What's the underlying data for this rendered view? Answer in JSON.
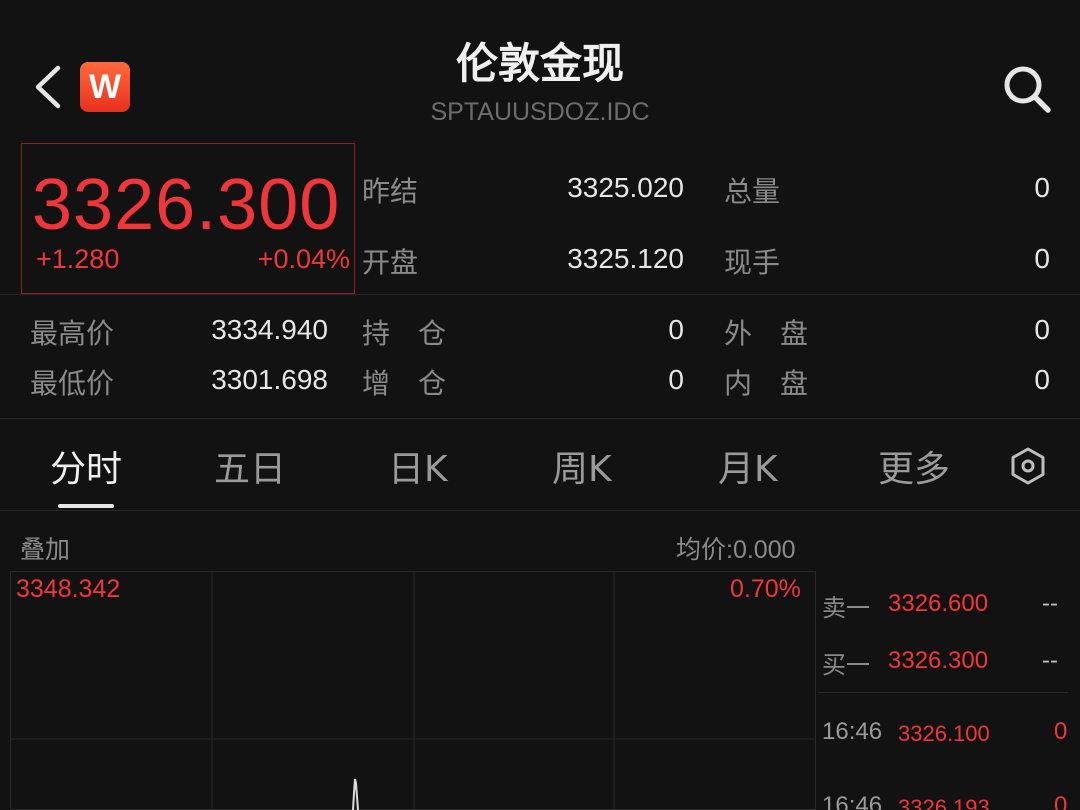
{
  "header": {
    "title": "伦敦金现",
    "symbol": "SPTAUUSDOZ.IDC",
    "logo_letter": "W"
  },
  "quote": {
    "price": "3326.300",
    "change": "+1.280",
    "change_pct": "+0.04%"
  },
  "stats": {
    "prev_settle_label": "昨结",
    "prev_settle": "3325.020",
    "total_vol_label": "总量",
    "total_vol": "0",
    "open_label": "开盘",
    "open": "3325.120",
    "cur_vol_label": "现手",
    "cur_vol": "0",
    "high_label": "最高价",
    "high": "3334.940",
    "oi_label": "持　仓",
    "oi": "0",
    "outer_label": "外　盘",
    "outer": "0",
    "low_label": "最低价",
    "low": "3301.698",
    "oi_chg_label": "增　仓",
    "oi_chg": "0",
    "inner_label": "内　盘",
    "inner": "0"
  },
  "tabs": [
    {
      "label": "分时",
      "active": true
    },
    {
      "label": "五日"
    },
    {
      "label": "日K"
    },
    {
      "label": "周K"
    },
    {
      "label": "月K"
    },
    {
      "label": "更多"
    }
  ],
  "chart": {
    "overlay_label": "叠加",
    "avg_price": "均价:0.000",
    "top_price": "3348.342",
    "top_pct": "0.70%"
  },
  "orderbook": {
    "ask_label": "卖一",
    "ask": "3326.600",
    "ask_vol": "--",
    "bid_label": "买一",
    "bid": "3326.300",
    "bid_vol": "--"
  },
  "ticks": [
    {
      "time": "16:46",
      "price": "3326.100",
      "vol": "0"
    },
    {
      "time": "16:46",
      "price": "3326.193",
      "vol": "0"
    }
  ],
  "colors": {
    "up": "#f0363b",
    "background": "#121212"
  }
}
